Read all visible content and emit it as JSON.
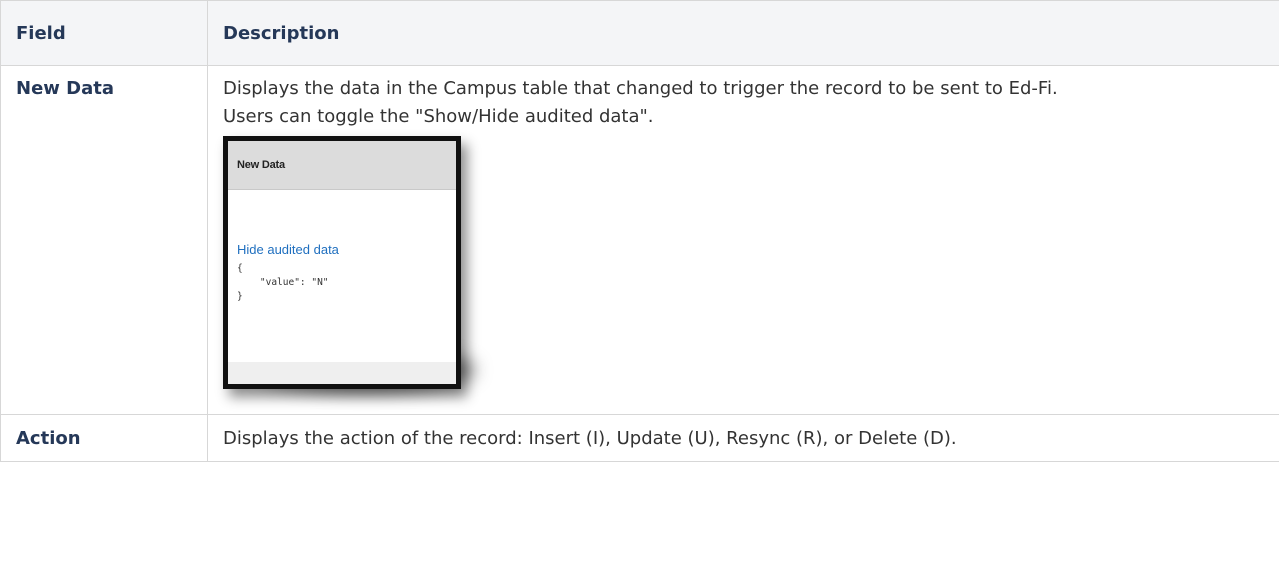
{
  "table": {
    "headers": {
      "field": "Field",
      "description": "Description"
    },
    "rows": [
      {
        "field": "New Data",
        "description_line1": "Displays the data in the Campus table that changed to trigger the record to be sent to Ed-Fi.",
        "description_line2": "Users can toggle the \"Show/Hide audited data\".",
        "screenshot": {
          "header_title": "New Data",
          "link_label": "Hide audited data",
          "code": "{\n    \"value\": \"N\"\n}"
        }
      },
      {
        "field": "Action",
        "description": "Displays the action of the record:  Insert (I), Update (U), Resync (R), or Delete (D)."
      }
    ]
  },
  "colors": {
    "header_background": "#f4f5f7",
    "field_text": "#253858",
    "border": "#d7d7d7",
    "link": "#1f6fbf"
  }
}
